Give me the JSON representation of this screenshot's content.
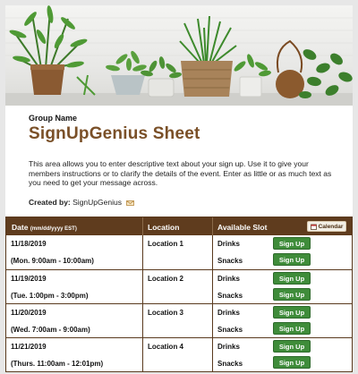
{
  "banner": {
    "icon": "potted-plants-photo"
  },
  "header": {
    "group_label": "Group Name",
    "title": "SignUpGenius Sheet",
    "intro": "This area allows you to enter descriptive text about your sign up. Use it to give your members instructions or to clarify the details of the event. Enter as little or as much text as you need to get your message across.",
    "created_by_label": "Created by:",
    "created_by_name": "SignUpGenius"
  },
  "table": {
    "date_header": "Date",
    "date_header_hint": "(mm/dd/yyyy EST)",
    "location_header": "Location",
    "slot_header": "Available Slot",
    "calendar_label": "Calendar",
    "rows": [
      {
        "date": "11/18/2019",
        "time": "(Mon. 9:00am - 10:00am)",
        "location": "Location 1",
        "slot1": "Drinks",
        "slot2": "Snacks",
        "button": "Sign Up"
      },
      {
        "date": "11/19/2019",
        "time": "(Tue. 1:00pm - 3:00pm)",
        "location": "Location 2",
        "slot1": "Drinks",
        "slot2": "Snacks",
        "button": "Sign Up"
      },
      {
        "date": "11/20/2019",
        "time": "(Wed. 7:00am - 9:00am)",
        "location": "Location 3",
        "slot1": "Drinks",
        "slot2": "Snacks",
        "button": "Sign Up"
      },
      {
        "date": "11/21/2019",
        "time": "(Thurs. 11:00am - 12:01pm)",
        "location": "Location 4",
        "slot1": "Drinks",
        "slot2": "Snacks",
        "button": "Sign Up"
      }
    ]
  },
  "colors": {
    "brand_brown": "#7a5028",
    "header_bg": "#5f3c1e",
    "signup_green": "#3f8c3a"
  }
}
